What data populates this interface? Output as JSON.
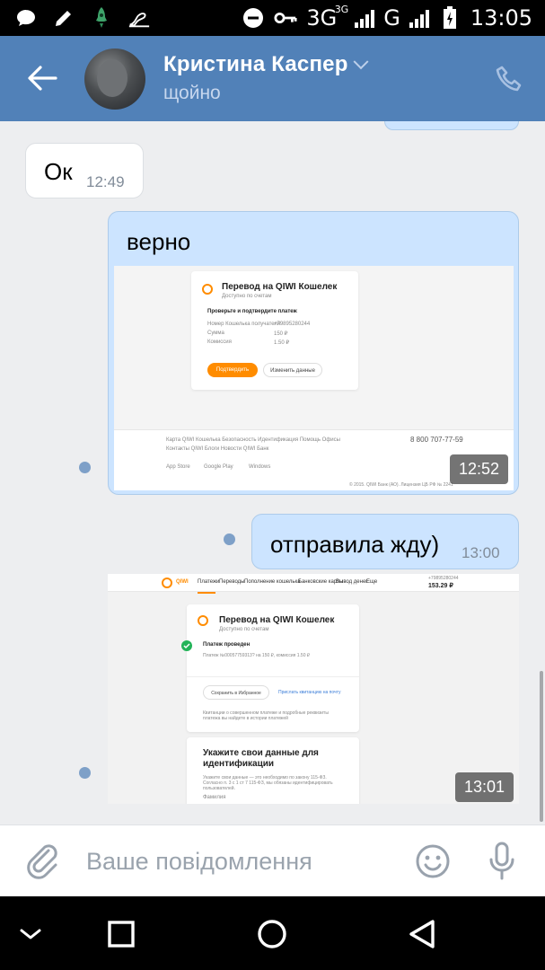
{
  "statusbar": {
    "network1": "3G",
    "network1_sup": "3G",
    "network2": "G",
    "time": "13:05"
  },
  "header": {
    "name": "Кристина Каспер",
    "status": "щойно"
  },
  "messages": [
    {
      "id": "m1",
      "direction": "in",
      "text": "Ок",
      "time": "12:49"
    },
    {
      "id": "m2",
      "direction": "out",
      "text": "верно",
      "time": "12:52",
      "attachment": "screenshot-1"
    },
    {
      "id": "m3",
      "direction": "out",
      "text": "отправила жду)",
      "time": "13:00"
    },
    {
      "id": "m4",
      "direction": "out",
      "text": "",
      "time": "13:01",
      "attachment": "screenshot-2"
    }
  ],
  "screenshot1": {
    "title": "Перевод на QIWI Кошелек",
    "subtitle": "Доступно по счетам",
    "section": "Проверьте и подтвердите платеж",
    "rows": [
      {
        "label": "Номер Кошелька получателя",
        "value": "+79895280244"
      },
      {
        "label": "Сумма",
        "value": "150 ₽"
      },
      {
        "label": "Комиссия",
        "value": "1.50 ₽"
      }
    ],
    "confirm_button": "Подтвердить",
    "edit_button": "Изменить данные",
    "footer_links": "Карта QIWI Кошелька   Безопасность   Идентификация   Помощь   Офисы",
    "footer_links2": "Контакты   QIWI Блоги   Новости   QIWI Банк",
    "phone": "8 800 707-77-59",
    "appstore": "App Store",
    "googleplay": "Google Play",
    "windows": "Windows",
    "copyright": "© 2015. QIWI Банк (АО). Лицензия ЦБ РФ № 2241"
  },
  "screenshot2": {
    "brand": "QIWI",
    "nav": [
      "Платежи",
      "Переводы",
      "Пополнение кошелька",
      "Банковские карты",
      "Вывод денег",
      "Еще"
    ],
    "phone": "+79895280244",
    "balance": "153.29 ₽",
    "title": "Перевод на QIWI Кошелек",
    "subtitle": "Доступно по счетам",
    "done": "Платеж проведен",
    "details": "Платеж №00057759313? на 150 ₽, комиссия 1.50 ₽",
    "save": "Сохранить в Избранное",
    "receipt": "Прислать квитанцию на почту",
    "note": "Квитанции о совершенном платеже и подробные реквизиты платежа вы найдете в истории платежей",
    "ident_title": "Укажите свои данные для идентификации",
    "ident_text": "Укажите свои данные — это необходимо по закону 115-ФЗ. Согласно п. 3 с 1 ст 7 115-ФЗ, мы обязаны идентифицировать пользователей.",
    "ident_field": "Фамилия"
  },
  "composer": {
    "placeholder": "Ваше повідомлення"
  },
  "colors": {
    "header": "#5181b8",
    "bubble_out": "#cce4ff",
    "bubble_in": "#ffffff",
    "background": "#edeef0",
    "qiwi_orange": "#ff8c00"
  }
}
